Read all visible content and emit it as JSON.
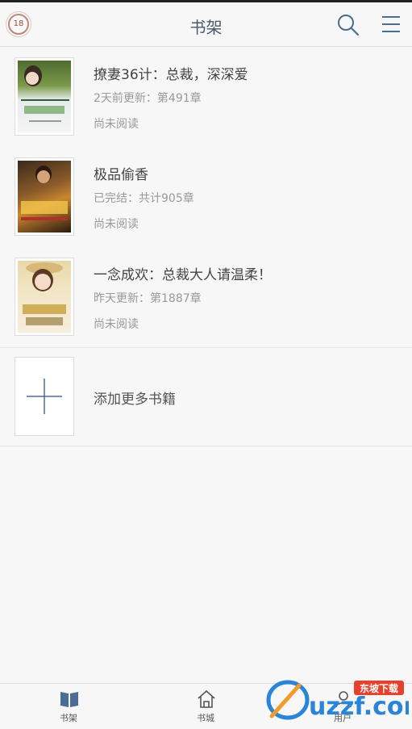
{
  "header": {
    "title": "书架",
    "logo_number": "18"
  },
  "books": [
    {
      "title": "撩妻36计：总裁，深深爱",
      "meta": "2天前更新：第491章",
      "status": "尚未阅读"
    },
    {
      "title": "极品偷香",
      "meta": "已完结：共计905章",
      "status": "尚未阅读"
    },
    {
      "title": "一念成欢：总裁大人请温柔！",
      "meta": "昨天更新：第1887章",
      "status": "尚未阅读"
    }
  ],
  "add_more": {
    "label": "添加更多书籍"
  },
  "tabs": [
    {
      "label": "书架"
    },
    {
      "label": "书城"
    },
    {
      "label": "用户"
    }
  ],
  "watermark": {
    "brand": "uzzf.com",
    "tag": "东坡下载"
  },
  "colors": {
    "accent": "#4a6d93",
    "header_text": "#4a5a6d",
    "meta_text": "#999999"
  }
}
